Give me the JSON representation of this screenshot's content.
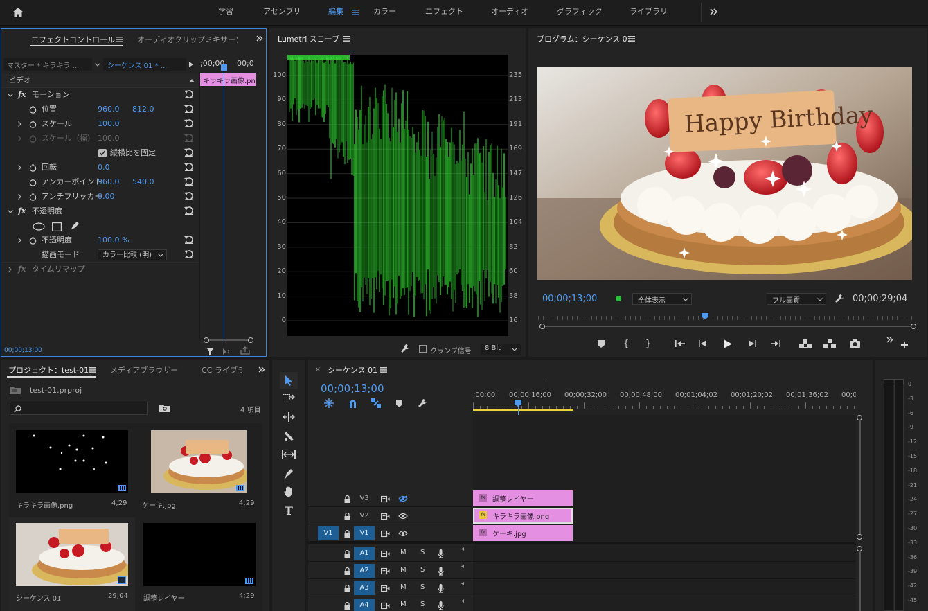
{
  "workspaces": {
    "home_icon": "home-icon",
    "items": [
      "学習",
      "アセンブリ",
      "編集",
      "カラー",
      "エフェクト",
      "オーディオ",
      "グラフィック",
      "ライブラリ"
    ],
    "active_index": 2,
    "more_icon": "double-chevron-right-icon"
  },
  "effect_controls": {
    "tab_active": "エフェクトコントロール",
    "tab_other": "オーディオクリップミキサー：シ",
    "master_label": "マスター * キラキラ ...",
    "sequence_label": "シーケンス 01 * ...",
    "timecode_header": ";00;00",
    "timecode_header2": "00;0",
    "clip_label": "キラキラ画像.pn",
    "section_video": "ビデオ",
    "motion": {
      "name": "モーション",
      "position_label": "位置",
      "position_x": "960.0",
      "position_y": "812.0",
      "scale_label": "スケール",
      "scale_value": "100.0",
      "scale_width_label": "スケール（幅）",
      "scale_width_value": "100.0",
      "uniform_label": "縦横比を固定",
      "rotation_label": "回転",
      "rotation_value": "0.0",
      "anchor_label": "アンカーポイント",
      "anchor_x": "960.0",
      "anchor_y": "540.0",
      "antiflicker_label": "アンチフリッカー",
      "antiflicker_value": "0.00"
    },
    "opacity": {
      "name": "不透明度",
      "opacity_label": "不透明度",
      "opacity_value": "100.0 %",
      "blend_label": "描画モード",
      "blend_value": "カラー比較 (明)"
    },
    "timeremap": "タイムリマップ",
    "footer_timecode": "00;00;13;00"
  },
  "lumetri": {
    "title": "Lumetri スコープ",
    "left_scale": [
      "100",
      "90",
      "80",
      "70",
      "60",
      "50",
      "40",
      "30",
      "20",
      "10",
      "0"
    ],
    "right_scale": [
      "235",
      "213",
      "191",
      "169",
      "147",
      "126",
      "104",
      "82",
      "60",
      "38",
      "16"
    ],
    "clamp_label": "クランプ信号",
    "bit_value": "8 Bit"
  },
  "program": {
    "title": "プログラム：シーケンス 01",
    "image_text": "Happy Birthday",
    "current_tc": "00;00;13;00",
    "zoom_value": "全体表示",
    "quality_value": "フル画質",
    "duration_tc": "00;00;29;04"
  },
  "project": {
    "tab_active": "プロジェクト：test-01",
    "tab_media": "メディアブラウザー",
    "tab_cc": "CC ライブラ",
    "file_name": "test-01.prproj",
    "item_count": "4 項目",
    "search_placeholder": "",
    "items": [
      {
        "name": "キラキラ画像.png",
        "duration": "4;29"
      },
      {
        "name": "ケーキ.jpg",
        "duration": "4;29"
      },
      {
        "name": "シーケンス 01",
        "duration": "29;04"
      },
      {
        "name": "調整レイヤー",
        "duration": "4;29"
      }
    ]
  },
  "timeline": {
    "tab": "シーケンス 01",
    "timecode": "00;00;13;00",
    "ruler": [
      ";00;00",
      "00;00;16;00",
      "00;00;32;00",
      "00;00;48;00",
      "00;01;04;02",
      "00;01;20;02",
      "00;01;36;02",
      "00;0"
    ],
    "video_tracks": [
      {
        "name": "V3",
        "clip": "調整レイヤー"
      },
      {
        "name": "V2",
        "clip": "キラキラ画像.png"
      },
      {
        "name": "V1",
        "clip": "ケーキ.jpg",
        "source": "V1"
      }
    ],
    "audio_tracks": [
      "A1",
      "A2",
      "A3",
      "A4"
    ],
    "mute_label": "M",
    "solo_label": "S"
  },
  "meter": {
    "labels": [
      "0",
      "-3",
      "-6",
      "-9",
      "-12",
      "-15",
      "-18",
      "-21",
      "-24",
      "-27",
      "-30",
      "-33",
      "-36",
      "-39",
      "-42",
      "-45"
    ]
  },
  "colors": {
    "accent_blue": "#4f9af0",
    "clip_pink": "#e58fe3",
    "scope_green": "#2fcf2f",
    "track_blue": "#1d5e94"
  }
}
